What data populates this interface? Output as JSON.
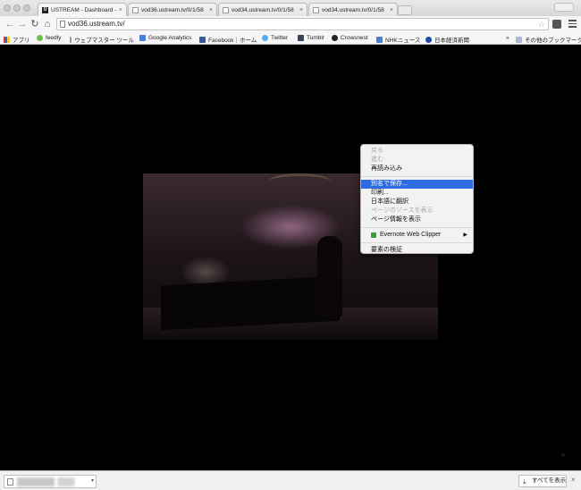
{
  "tabs": [
    {
      "label": "USTREAM - Dashboard - U",
      "icon": "ustream-icon"
    },
    {
      "label": "vod36.ustream.tv/0/1/58",
      "icon": "document-icon"
    },
    {
      "label": "vod34.ustream.tv/0/1/58",
      "icon": "document-icon"
    },
    {
      "label": "vod34.ustream.tv/0/1/58",
      "icon": "document-icon"
    }
  ],
  "tab_favicon_text": "U",
  "tab_close_glyph": "×",
  "address_bar": {
    "url": "vod36.ustream.tv/"
  },
  "toolbar_icons": {
    "back": "←",
    "forward": "→",
    "reload": "↻",
    "home": "⌂",
    "star": "☆"
  },
  "bookmarks": [
    {
      "label": "アプリ",
      "icon": "apps-icon"
    },
    {
      "label": "feedly",
      "icon": "feedly-icon"
    },
    {
      "label": "ウェブマスター ツール",
      "icon": "document-icon"
    },
    {
      "label": "Google Analytics",
      "icon": "analytics-icon"
    },
    {
      "label": "Facebook｜ホーム",
      "icon": "facebook-icon"
    },
    {
      "label": "Twitter",
      "icon": "twitter-icon"
    },
    {
      "label": "Tumblr",
      "icon": "tumblr-icon"
    },
    {
      "label": "Crowsnest",
      "icon": "crowsnest-icon"
    },
    {
      "label": "NHKニュース",
      "icon": "nhk-icon"
    },
    {
      "label": "日本経済新聞",
      "icon": "nikkei-icon"
    },
    {
      "label": "その他のブックマーク",
      "icon": "folder-icon"
    }
  ],
  "bookmark_overflow": "»",
  "context_menu": {
    "back": "戻る",
    "forward": "進む",
    "reload": "再読み込み",
    "save_as": "別名で保存...",
    "print": "印刷...",
    "translate": "日本語に翻訳",
    "view_source": "ページのソースを表示",
    "page_info": "ページ情報を表示",
    "evernote": "Evernote Web Clipper",
    "inspect": "要素の検証",
    "submenu_arrow": "▶"
  },
  "side_chevron": "«",
  "download_shelf": {
    "item_dropdown": "▾",
    "show_all": "すべてを表示",
    "show_all_icon": "⤓",
    "close": "×"
  }
}
